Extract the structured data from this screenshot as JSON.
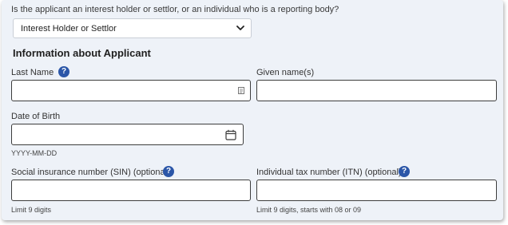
{
  "question": "Is the applicant an interest holder or settlor, or an individual who is a reporting body?",
  "applicant_type_select": {
    "value": "Interest Holder or Settlor"
  },
  "section_title": "Information about Applicant",
  "fields": {
    "last_name": {
      "label": "Last Name",
      "value": ""
    },
    "given_names": {
      "label": "Given name(s)",
      "value": ""
    },
    "date_of_birth": {
      "label": "Date of Birth",
      "value": "",
      "hint": "YYYY-MM-DD"
    },
    "sin": {
      "label": "Social insurance number (SIN) (optional)",
      "value": "",
      "hint": "Limit 9 digits"
    },
    "itn": {
      "label": "Individual tax number (ITN) (optional)",
      "value": "",
      "hint": "Limit 9 digits, starts with 08 or 09"
    }
  },
  "help_icon_glyph": "?",
  "icons": {
    "help": "question-circle-icon",
    "calendar": "calendar-icon",
    "autofill": "contact-card-icon",
    "dropdown": "chevron-down-icon"
  },
  "colors": {
    "panel_background": "#eef2f8",
    "help_icon": "#2b56a8",
    "input_border": "#3d3d3d"
  }
}
